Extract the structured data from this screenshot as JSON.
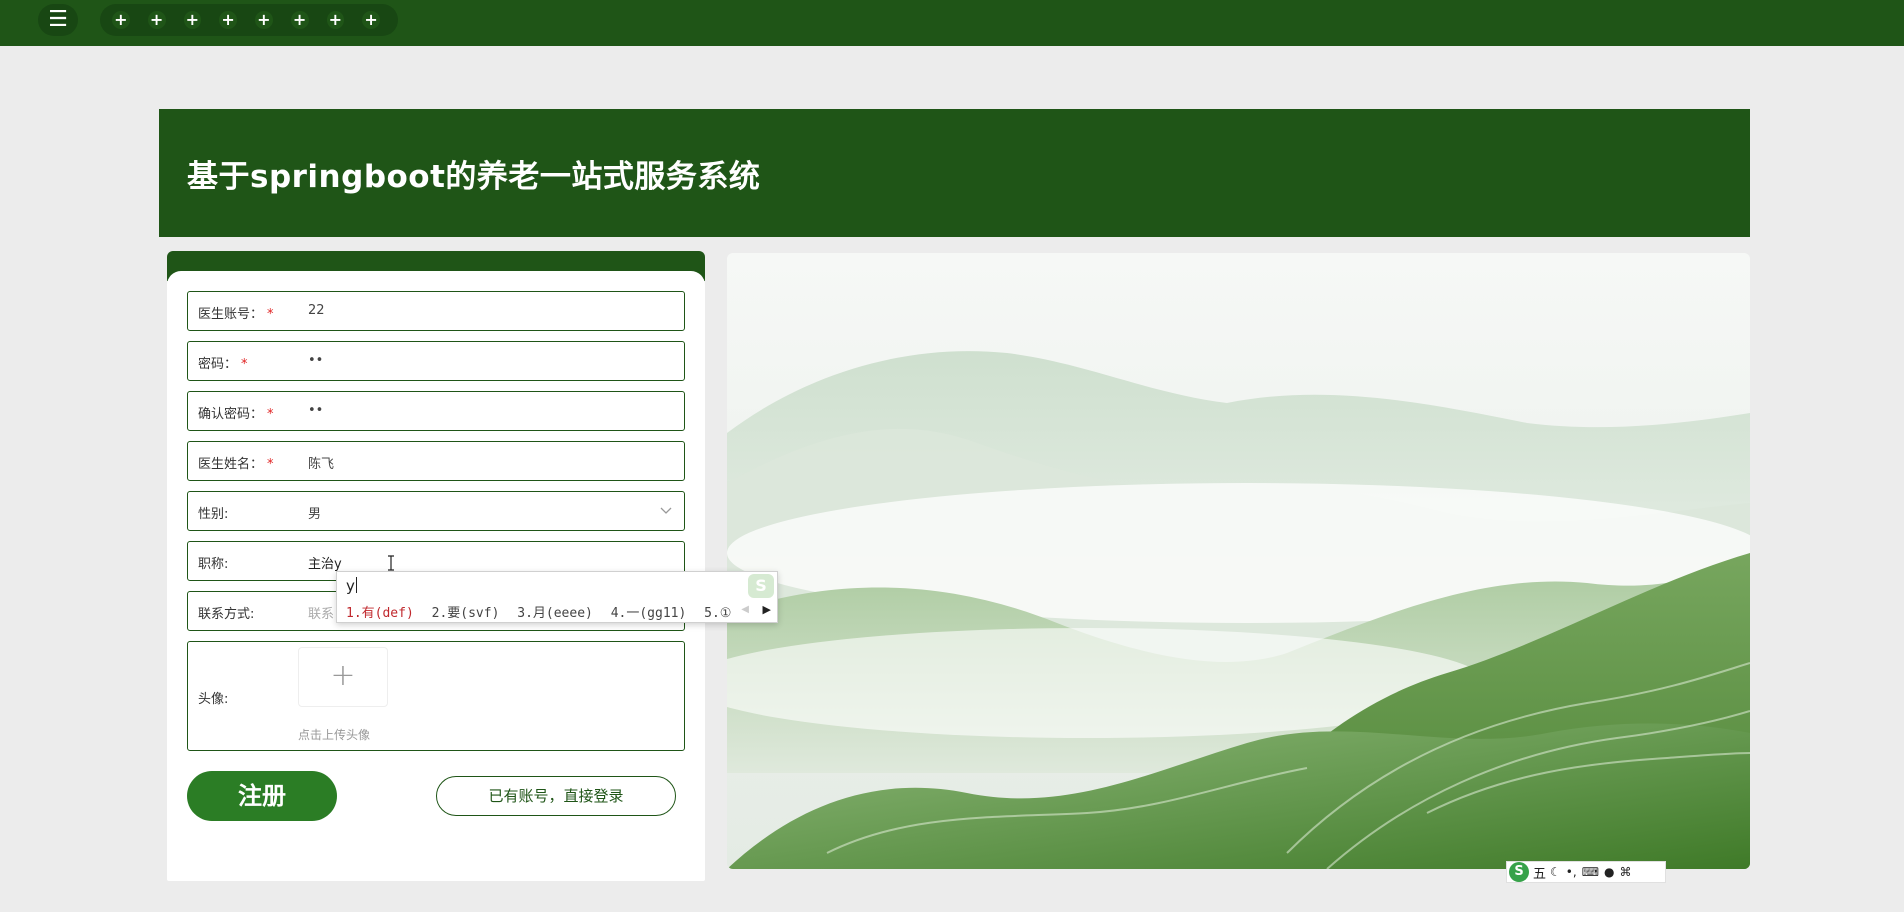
{
  "topbar": {
    "menu_icon": "☰",
    "plus_icon": "+",
    "plus_count": 8
  },
  "header": {
    "title": "基于springboot的养老一站式服务系统"
  },
  "form": {
    "fields": [
      {
        "label": "医生账号：",
        "required_mark": "*",
        "value": "22"
      },
      {
        "label": "密码：",
        "required_mark": "*",
        "value": "••"
      },
      {
        "label": "确认密码：",
        "required_mark": "*",
        "value": "••"
      },
      {
        "label": "医生姓名：",
        "required_mark": "*",
        "value": "陈飞"
      },
      {
        "label": "性别:",
        "value": "男"
      },
      {
        "label": "职称:",
        "value": "主治y"
      },
      {
        "label": "联系方式:",
        "placeholder": "联系"
      }
    ],
    "avatar": {
      "label": "头像:",
      "upload_icon": "+",
      "hint": "点击上传头像"
    },
    "register_label": "注册",
    "login_label": "已有账号，直接登录"
  },
  "ime": {
    "composition": "y",
    "candidates": [
      "1.有(def)",
      "2.要(svf)",
      "3.月(eeee)",
      "4.一(gg11)",
      "5.①"
    ],
    "logo": "S",
    "prev_icon": "◀",
    "next_icon": "▶"
  },
  "ime_toolbar": {
    "logo": "S",
    "mode": "五",
    "icons": [
      "☾",
      "•,",
      "⌨",
      "●",
      "⌘"
    ]
  },
  "colors": {
    "primary": "#1f5517",
    "button": "#2b7d25",
    "required": "#e02020",
    "background": "#ececec"
  }
}
